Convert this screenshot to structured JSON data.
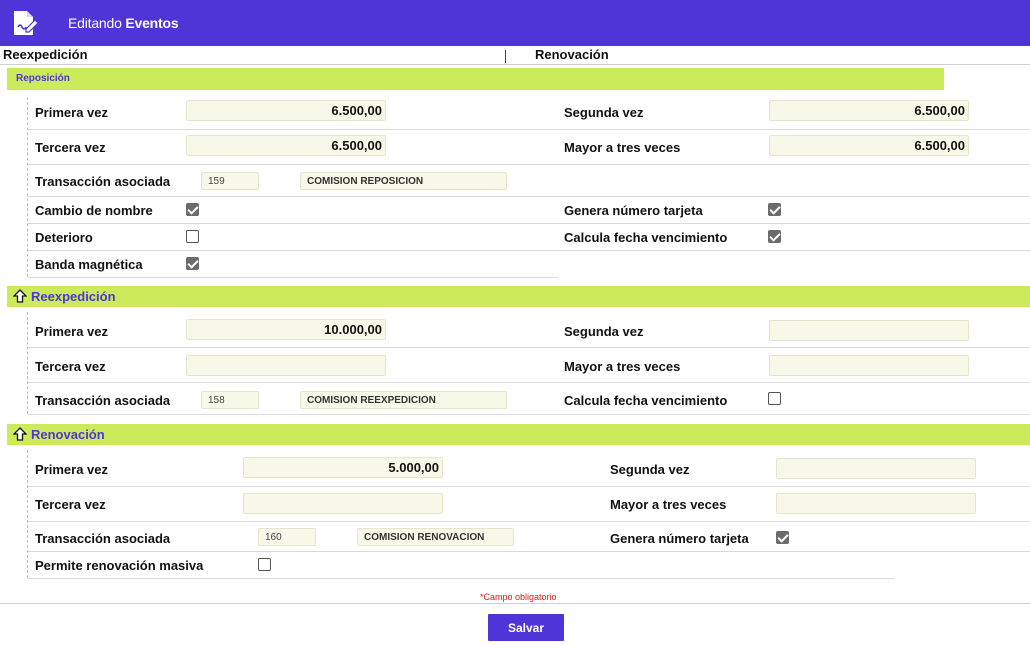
{
  "header": {
    "title_prefix": "Editando",
    "title_entity": "Eventos",
    "icon": "edit-document-icon"
  },
  "tabs": [
    {
      "label": "Reexpedición"
    },
    {
      "label": "Renovación"
    }
  ],
  "reposicion": {
    "title": "Reposición",
    "primera_vez": {
      "label": "Primera vez",
      "value": "6.500,00"
    },
    "segunda_vez": {
      "label": "Segunda vez",
      "value": "6.500,00"
    },
    "tercera_vez": {
      "label": "Tercera vez",
      "value": "6.500,00"
    },
    "mayor_tres": {
      "label": "Mayor a tres veces",
      "value": "6.500,00"
    },
    "transaccion": {
      "label": "Transacción asociada",
      "code": "159",
      "description": "COMISION REPOSICION"
    },
    "cambio_nombre": {
      "label": "Cambio de nombre",
      "checked": true
    },
    "genera_numero": {
      "label": "Genera número tarjeta",
      "checked": true
    },
    "deterioro": {
      "label": "Deterioro",
      "checked": false
    },
    "calcula_fecha": {
      "label": "Calcula fecha vencimiento",
      "checked": true
    },
    "banda_magnetica": {
      "label": "Banda magnética",
      "checked": true
    }
  },
  "reexpedicion": {
    "title": "Reexpedición",
    "icon": "arrow-up-icon",
    "primera_vez": {
      "label": "Primera vez",
      "value": "10.000,00"
    },
    "segunda_vez": {
      "label": "Segunda vez",
      "value": ""
    },
    "tercera_vez": {
      "label": "Tercera vez",
      "value": ""
    },
    "mayor_tres": {
      "label": "Mayor a tres veces",
      "value": ""
    },
    "transaccion": {
      "label": "Transacción asociada",
      "code": "158",
      "description": "COMISION REEXPEDICION"
    },
    "calcula_fecha": {
      "label": "Calcula fecha vencimiento",
      "checked": false
    }
  },
  "renovacion": {
    "title": "Renovación",
    "icon": "arrow-up-icon",
    "primera_vez": {
      "label": "Primera vez",
      "value": "5.000,00"
    },
    "segunda_vez": {
      "label": "Segunda vez",
      "value": ""
    },
    "tercera_vez": {
      "label": "Tercera vez",
      "value": ""
    },
    "mayor_tres": {
      "label": "Mayor a tres veces",
      "value": ""
    },
    "transaccion": {
      "label": "Transacción asociada",
      "code": "160",
      "description": "COMISION RENOVACION"
    },
    "genera_numero": {
      "label": "Genera número tarjeta",
      "checked": true
    },
    "renovacion_masiva": {
      "label": "Permite renovación masiva",
      "checked": false
    }
  },
  "footer": {
    "required_note": "*Campo obligatorio",
    "save_label": "Salvar"
  },
  "colors": {
    "accent": "#4f35d8",
    "band": "#cdea5a",
    "field_bg": "#f7f8e8",
    "required": "#e01818"
  }
}
